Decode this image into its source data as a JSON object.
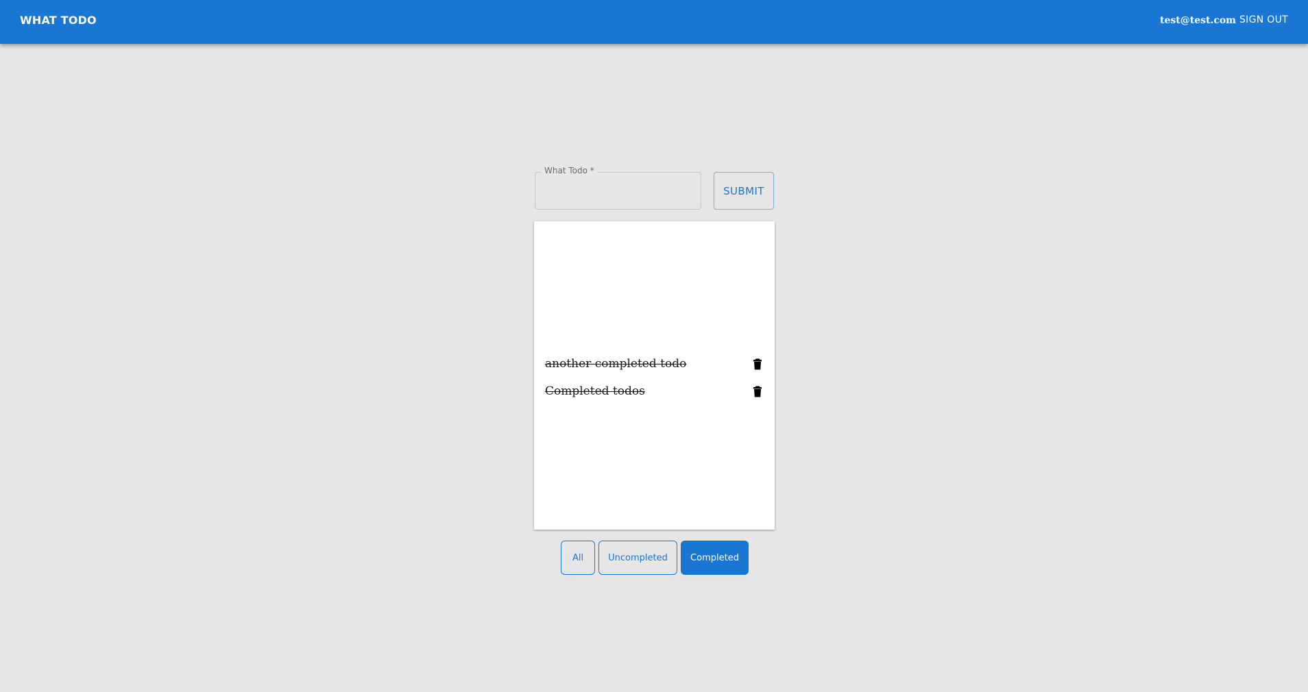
{
  "app": {
    "brand": "WHAT TODO",
    "user_email": "test@test.com",
    "sign_out_label": "SIGN OUT"
  },
  "form": {
    "label": "What Todo *",
    "value": "",
    "submit_label": "SUBMIT"
  },
  "todos": [
    {
      "text": "another completed todo",
      "completed": true,
      "delete_icon": "trash-icon"
    },
    {
      "text": "Completed todos",
      "completed": true,
      "delete_icon": "trash-icon"
    }
  ],
  "filters": {
    "all_label": "All",
    "uncompleted_label": "Uncompleted",
    "completed_label": "Completed",
    "selected": "Completed"
  },
  "colors": {
    "primary": "#1976d2",
    "background": "#e6e6e6",
    "panel": "#ffffff"
  }
}
